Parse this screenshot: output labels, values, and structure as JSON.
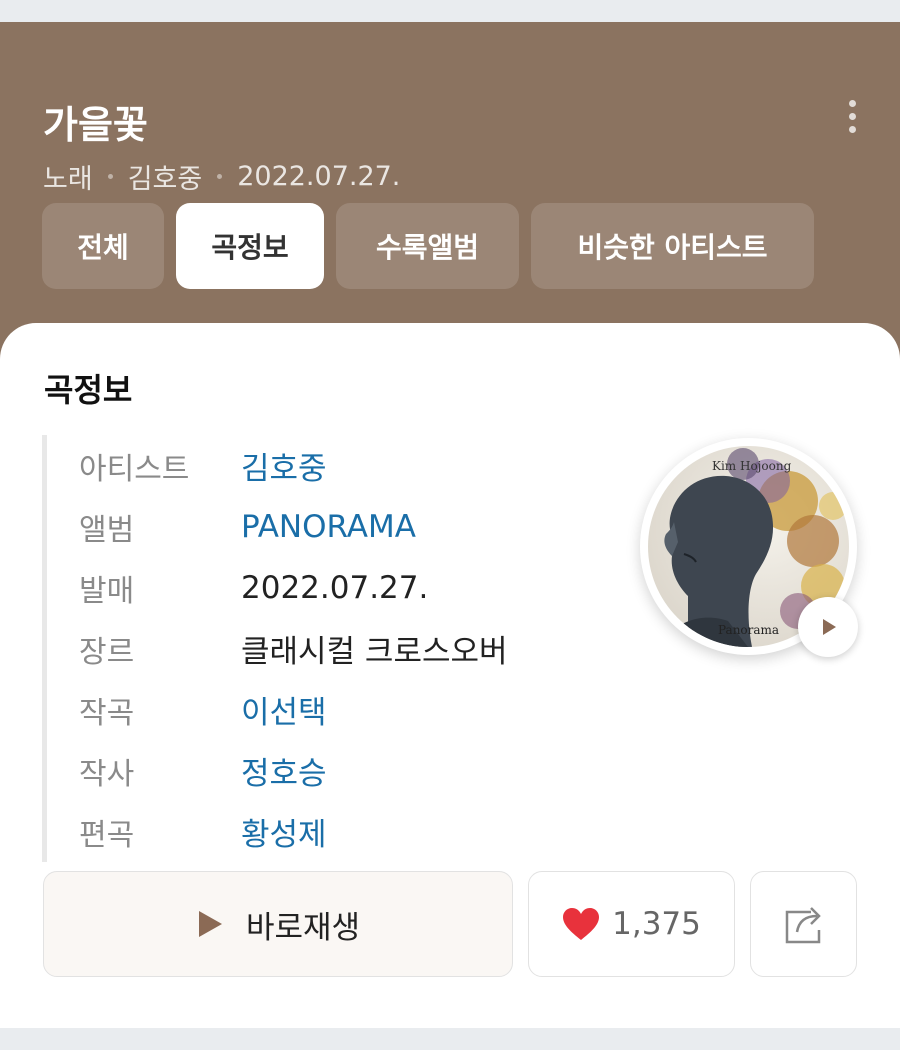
{
  "header": {
    "title": "가을꽃",
    "meta": [
      "노래",
      "김호중",
      "2022.07.27."
    ],
    "tabs": [
      {
        "label": "전체",
        "active": false
      },
      {
        "label": "곡정보",
        "active": true
      },
      {
        "label": "수록앨범",
        "active": false
      },
      {
        "label": "비슷한 아티스트",
        "active": false
      }
    ],
    "colors": {
      "background": "#8b7360",
      "text": "#ffffff"
    }
  },
  "info": {
    "section_title": "곡정보",
    "rows": [
      {
        "label": "아티스트",
        "value": "김호중",
        "link": true
      },
      {
        "label": "앨범",
        "value": "PANORAMA",
        "link": true
      },
      {
        "label": "발매",
        "value": "2022.07.27.",
        "link": false
      },
      {
        "label": "장르",
        "value": "클래시컬 크로스오버",
        "link": false
      },
      {
        "label": "작곡",
        "value": "이선택",
        "link": true
      },
      {
        "label": "작사",
        "value": "정호승",
        "link": true
      },
      {
        "label": "편곡",
        "value": "황성제",
        "link": true
      }
    ],
    "link_color": "#1a6ea8"
  },
  "album": {
    "cover_text_top": "Kim Hojoong",
    "cover_text_bottom": "Panorama"
  },
  "actions": {
    "play_label": "바로재생",
    "like_count": "1,375",
    "like_color": "#e8323c",
    "play_icon_color": "#8b6a55"
  }
}
